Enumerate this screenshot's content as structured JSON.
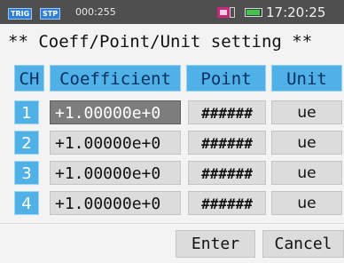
{
  "status_bar": {
    "trig_label": "TRIG",
    "step_label": "STP",
    "counter": "000:255",
    "clock": "17:20:25",
    "battery_level": 0.85
  },
  "title": "** Coeff/Point/Unit setting **",
  "table": {
    "headers": {
      "ch": "CH",
      "coefficient": "Coefficient",
      "point": "Point",
      "unit": "Unit"
    },
    "rows": [
      {
        "ch": "1",
        "coefficient": "+1.00000e+0",
        "point": "######",
        "unit": "ue",
        "selected": true
      },
      {
        "ch": "2",
        "coefficient": "+1.00000e+0",
        "point": "######",
        "unit": "ue"
      },
      {
        "ch": "3",
        "coefficient": "+1.00000e+0",
        "point": "######",
        "unit": "ue"
      },
      {
        "ch": "4",
        "coefficient": "+1.00000e+0",
        "point": "######",
        "unit": "ue"
      }
    ]
  },
  "buttons": {
    "enter": "Enter",
    "cancel": "Cancel"
  },
  "colors": {
    "header_blue": "#4fb1e6",
    "selected_gray": "#7d7d7d",
    "status_bar": "#4f4f4f"
  },
  "icons": [
    "memory-card-icon",
    "battery-icon"
  ]
}
